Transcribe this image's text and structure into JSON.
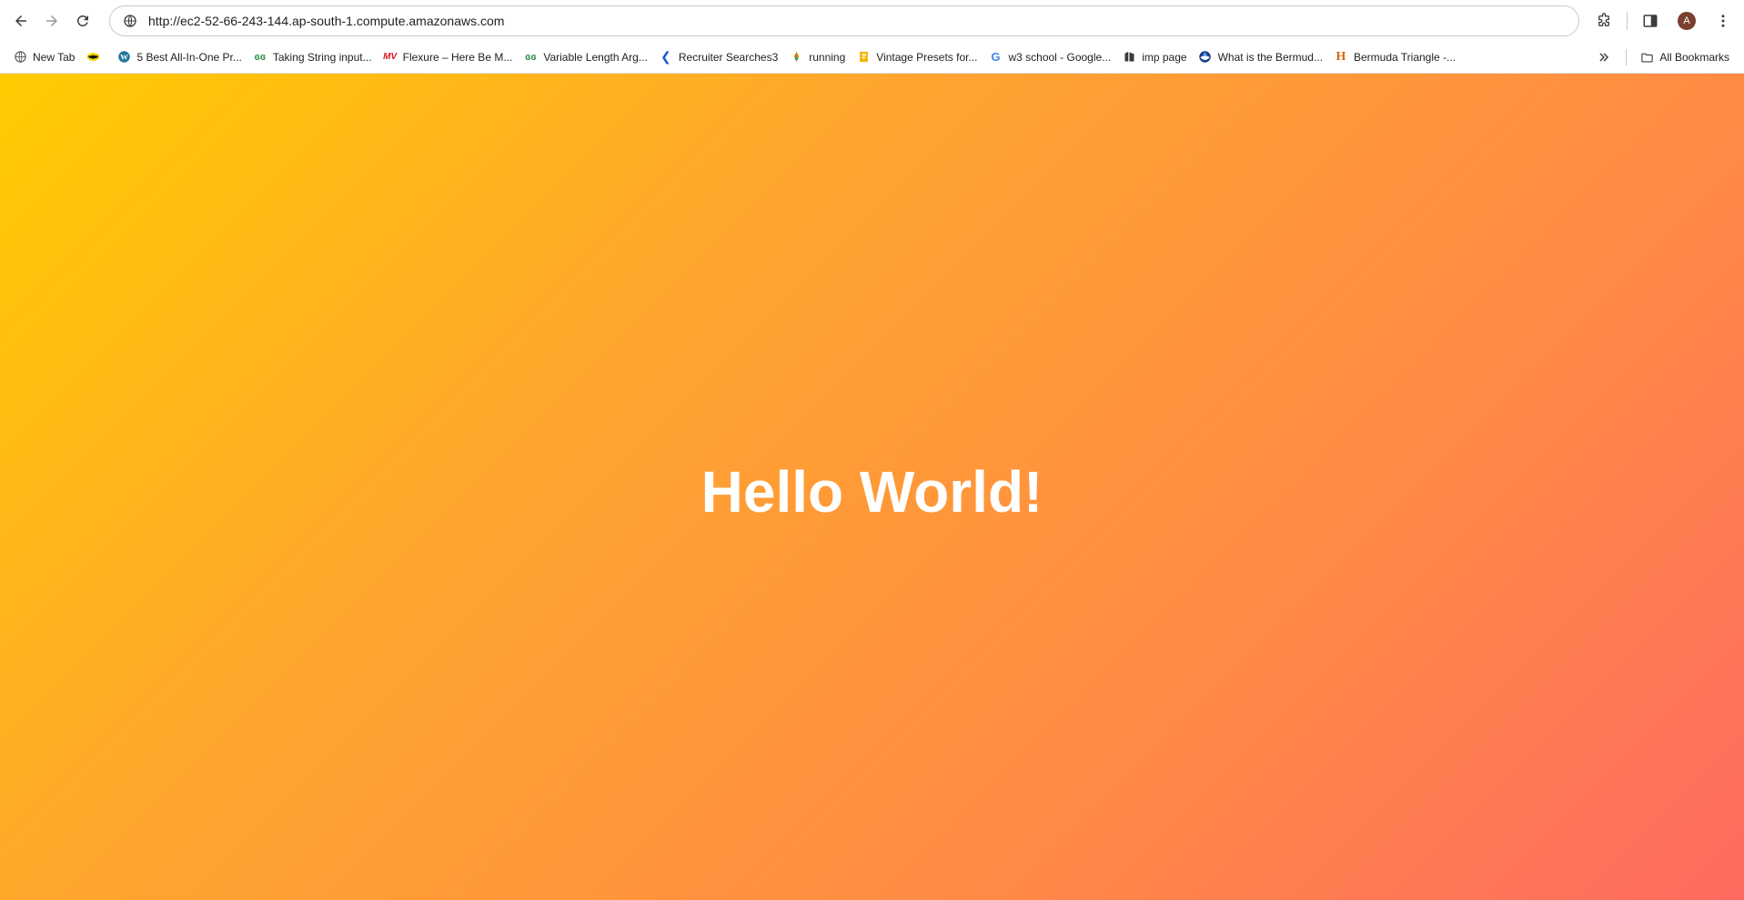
{
  "toolbar": {
    "back_icon": "back-arrow-icon",
    "forward_icon": "forward-arrow-icon",
    "reload_icon": "reload-icon",
    "url": "http://ec2-52-66-243-144.ap-south-1.compute.amazonaws.com",
    "site_info_icon": "site-info-icon",
    "extensions_icon": "extensions-icon",
    "sidepanel_icon": "side-panel-icon",
    "profile_initial": "A",
    "profile_color": "#7b3f2f",
    "menu_icon": "more-vert-icon"
  },
  "bookmarks": {
    "items": [
      {
        "label": "New Tab",
        "icon": "globe-icon"
      },
      {
        "label": "",
        "icon": "batman-icon"
      },
      {
        "label": "5 Best All-In-One Pr...",
        "icon": "wordpress-icon"
      },
      {
        "label": "Taking String input...",
        "icon": "geeksforgeeks-icon"
      },
      {
        "label": "Flexure – Here Be M...",
        "icon": "mv-icon"
      },
      {
        "label": "Variable Length Arg...",
        "icon": "geeksforgeeks-icon"
      },
      {
        "label": "Recruiter Searches3",
        "icon": "recruiter-icon"
      },
      {
        "label": "running",
        "icon": "running-icon"
      },
      {
        "label": "Vintage Presets for...",
        "icon": "presets-icon"
      },
      {
        "label": "w3 school - Google...",
        "icon": "google-icon"
      },
      {
        "label": "imp page",
        "icon": "page-icon"
      },
      {
        "label": "What is the Bermud...",
        "icon": "noaa-icon"
      },
      {
        "label": "Bermuda Triangle -...",
        "icon": "history-icon"
      }
    ],
    "overflow_icon": "chevron-double-right-icon",
    "all_bookmarks_label": "All Bookmarks",
    "all_bookmarks_icon": "folder-icon"
  },
  "page": {
    "headline": "Hello World!",
    "gradient_colors": [
      "#ffcc00",
      "#ffa52e",
      "#ff8a45",
      "#ff6a60"
    ],
    "text_color": "#ffffff"
  }
}
